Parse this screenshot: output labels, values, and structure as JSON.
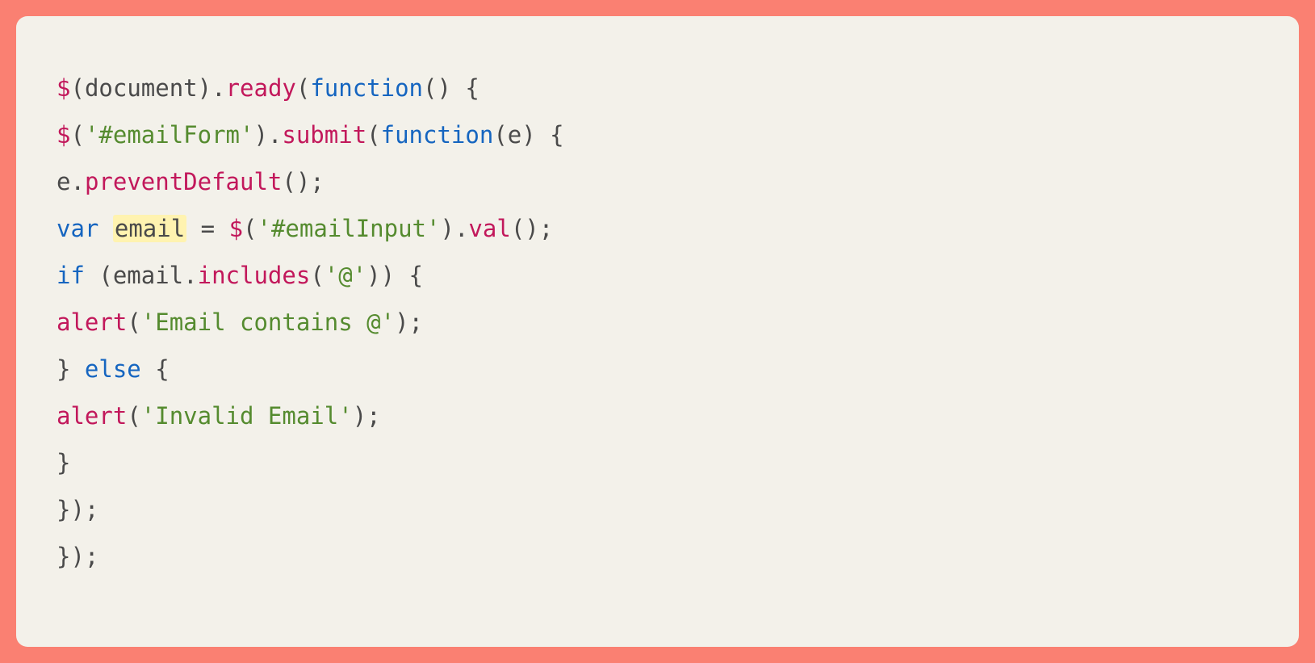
{
  "code": {
    "lines": [
      {
        "tokens": [
          {
            "t": "$",
            "c": "tok-dollar"
          },
          {
            "t": "(",
            "c": "tok-punc"
          },
          {
            "t": "document",
            "c": "tok-ident"
          },
          {
            "t": ")",
            "c": "tok-punc"
          },
          {
            "t": ".",
            "c": "tok-punc"
          },
          {
            "t": "ready",
            "c": "tok-func"
          },
          {
            "t": "(",
            "c": "tok-punc"
          },
          {
            "t": "function",
            "c": "tok-kw"
          },
          {
            "t": "()",
            "c": "tok-punc"
          },
          {
            "t": " {",
            "c": "tok-punc"
          }
        ]
      },
      {
        "tokens": [
          {
            "t": "$",
            "c": "tok-dollar"
          },
          {
            "t": "(",
            "c": "tok-punc"
          },
          {
            "t": "'#emailForm'",
            "c": "tok-str"
          },
          {
            "t": ")",
            "c": "tok-punc"
          },
          {
            "t": ".",
            "c": "tok-punc"
          },
          {
            "t": "submit",
            "c": "tok-func"
          },
          {
            "t": "(",
            "c": "tok-punc"
          },
          {
            "t": "function",
            "c": "tok-kw"
          },
          {
            "t": "(",
            "c": "tok-punc"
          },
          {
            "t": "e",
            "c": "tok-ident"
          },
          {
            "t": ")",
            "c": "tok-punc"
          },
          {
            "t": " {",
            "c": "tok-punc"
          }
        ]
      },
      {
        "tokens": [
          {
            "t": "e",
            "c": "tok-ident"
          },
          {
            "t": ".",
            "c": "tok-punc"
          },
          {
            "t": "preventDefault",
            "c": "tok-func"
          },
          {
            "t": "();",
            "c": "tok-punc"
          }
        ]
      },
      {
        "tokens": [
          {
            "t": "var",
            "c": "tok-kw"
          },
          {
            "t": " ",
            "c": "tok-punc"
          },
          {
            "t": "email",
            "c": "tok-ident hlvar"
          },
          {
            "t": " = ",
            "c": "tok-op"
          },
          {
            "t": "$",
            "c": "tok-dollar"
          },
          {
            "t": "(",
            "c": "tok-punc"
          },
          {
            "t": "'#emailInput'",
            "c": "tok-str"
          },
          {
            "t": ")",
            "c": "tok-punc"
          },
          {
            "t": ".",
            "c": "tok-punc"
          },
          {
            "t": "val",
            "c": "tok-func"
          },
          {
            "t": "();",
            "c": "tok-punc"
          }
        ]
      },
      {
        "tokens": [
          {
            "t": "if",
            "c": "tok-kw"
          },
          {
            "t": " (",
            "c": "tok-punc"
          },
          {
            "t": "email",
            "c": "tok-ident"
          },
          {
            "t": ".",
            "c": "tok-punc"
          },
          {
            "t": "includes",
            "c": "tok-func"
          },
          {
            "t": "(",
            "c": "tok-punc"
          },
          {
            "t": "'@'",
            "c": "tok-str"
          },
          {
            "t": "))",
            "c": "tok-punc"
          },
          {
            "t": " {",
            "c": "tok-punc"
          }
        ]
      },
      {
        "tokens": [
          {
            "t": "alert",
            "c": "tok-func"
          },
          {
            "t": "(",
            "c": "tok-punc"
          },
          {
            "t": "'Email contains @'",
            "c": "tok-str"
          },
          {
            "t": ");",
            "c": "tok-punc"
          }
        ]
      },
      {
        "tokens": [
          {
            "t": "} ",
            "c": "tok-punc"
          },
          {
            "t": "else",
            "c": "tok-kw"
          },
          {
            "t": " {",
            "c": "tok-punc"
          }
        ]
      },
      {
        "tokens": [
          {
            "t": "alert",
            "c": "tok-func"
          },
          {
            "t": "(",
            "c": "tok-punc"
          },
          {
            "t": "'Invalid Email'",
            "c": "tok-str"
          },
          {
            "t": ");",
            "c": "tok-punc"
          }
        ]
      },
      {
        "tokens": [
          {
            "t": "}",
            "c": "tok-punc"
          }
        ]
      },
      {
        "tokens": [
          {
            "t": "});",
            "c": "tok-punc"
          }
        ]
      },
      {
        "tokens": [
          {
            "t": "});",
            "c": "tok-punc"
          }
        ]
      }
    ]
  }
}
